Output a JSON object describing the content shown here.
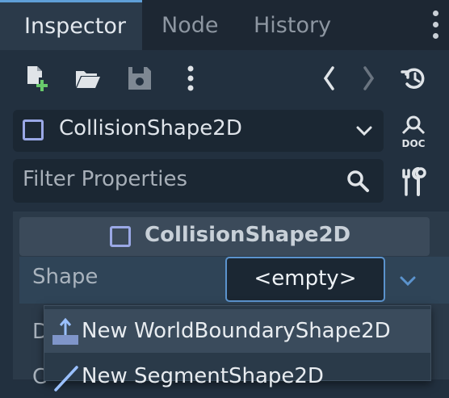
{
  "tabs": [
    {
      "label": "Inspector",
      "active": true
    },
    {
      "label": "Node",
      "active": false
    },
    {
      "label": "History",
      "active": false
    }
  ],
  "toolbar": {
    "icons": [
      "new-resource-icon",
      "open-folder-icon",
      "save-icon",
      "kebab-menu-icon",
      "back-icon",
      "forward-icon",
      "history-icon"
    ]
  },
  "object_selector": {
    "class_name": "CollisionShape2D",
    "doc_label": "DOC"
  },
  "filter": {
    "placeholder": "Filter Properties"
  },
  "section": {
    "title": "CollisionShape2D"
  },
  "property": {
    "label": "Shape",
    "value": "<empty>"
  },
  "dropdown": {
    "items": [
      {
        "label": "New WorldBoundaryShape2D",
        "icon": "world-boundary-icon"
      },
      {
        "label": "New SegmentShape2D",
        "icon": "segment-icon"
      }
    ]
  },
  "colors": {
    "accent": "#5f9fd8",
    "node_icon": "#9aa8e6",
    "background": "#22303f"
  }
}
